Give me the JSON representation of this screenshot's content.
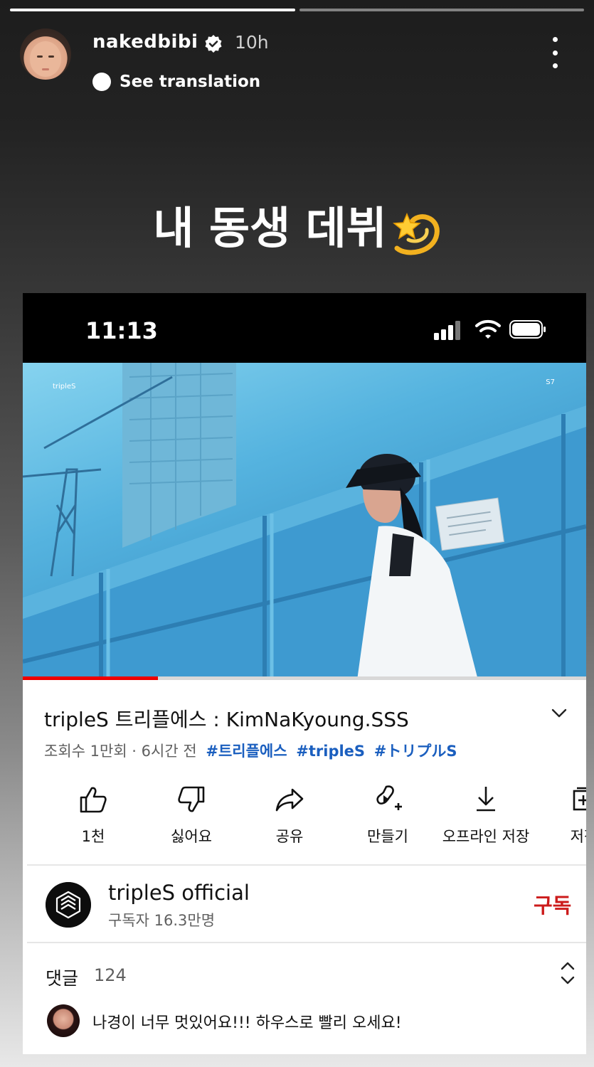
{
  "story": {
    "username": "nakedbibi",
    "time_ago": "10h",
    "see_translation": "See translation",
    "caption": "내 동생 데뷔",
    "caption_emoji": "dizzy-star-icon",
    "progress": [
      1.0,
      0.0
    ]
  },
  "phone": {
    "time": "11:13",
    "video": {
      "watermark_left": "tripleS",
      "watermark_right": "S7",
      "progress_fraction": 0.24
    },
    "title": "tripleS 트리플에스 : KimNaKyoung.SSS",
    "meta_text": "조회수 1만회 · 6시간 전",
    "hashtags": [
      "#트리플에스",
      "#tripleS",
      "#トリプルS"
    ],
    "actions": [
      {
        "label": "1천",
        "icon": "thumbs-up-icon"
      },
      {
        "label": "싫어요",
        "icon": "thumbs-down-icon"
      },
      {
        "label": "공유",
        "icon": "share-icon"
      },
      {
        "label": "만들기",
        "icon": "remix-icon"
      },
      {
        "label": "오프라인 저장",
        "icon": "download-icon"
      },
      {
        "label": "저장",
        "icon": "save-icon"
      }
    ],
    "channel": {
      "name": "tripleS official",
      "subscribers": "구독자 16.3만명",
      "subscribe_label": "구독"
    },
    "comments": {
      "label": "댓글",
      "count": "124",
      "top_comment": "나경이 너무 멋있어요!!! 하우스로 빨리 오세요!"
    }
  }
}
